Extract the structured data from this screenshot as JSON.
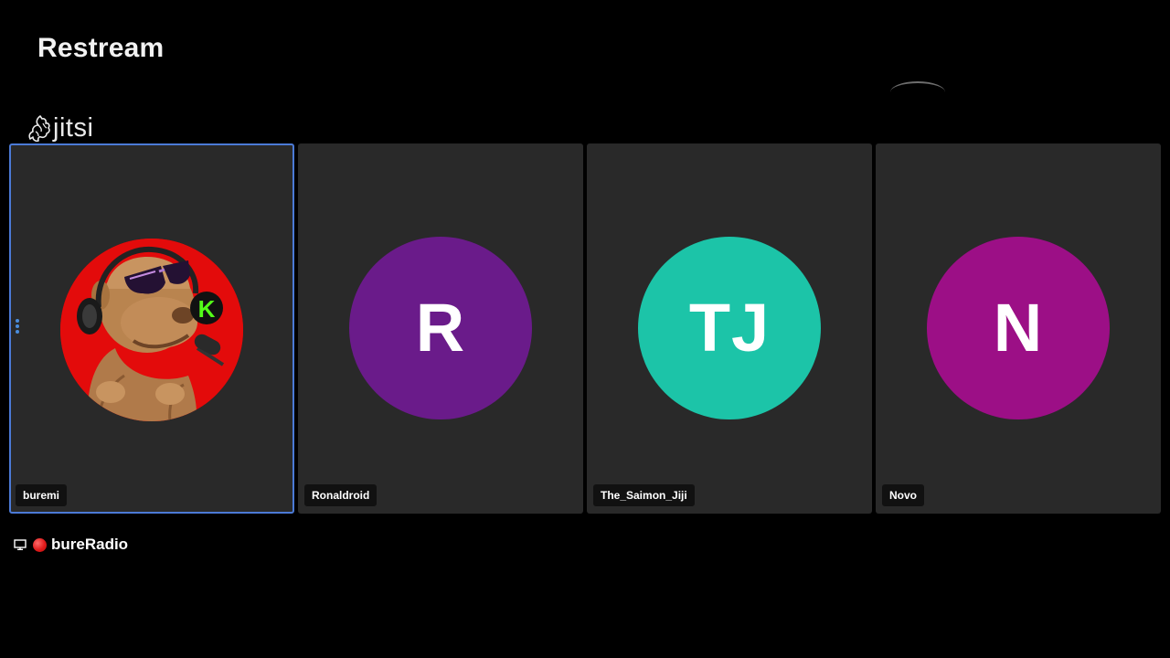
{
  "header": {
    "title": "Restream"
  },
  "logo": {
    "text": "jitsi",
    "icon": "jitsi-logo-icon"
  },
  "participants": [
    {
      "name": "buremi",
      "initials": "",
      "avatar_type": "image",
      "avatar_color": "#e60000",
      "active": true
    },
    {
      "name": "Ronaldroid",
      "initials": "R",
      "avatar_type": "initials",
      "avatar_color": "#6a1b8a",
      "active": false
    },
    {
      "name": "The_Saimon_Jiji",
      "initials": "TJ",
      "avatar_type": "initials",
      "avatar_color": "#1cc4a8",
      "active": false
    },
    {
      "name": "Novo",
      "initials": "N",
      "avatar_type": "initials",
      "avatar_color": "#9c0f86",
      "active": false
    }
  ],
  "footer": {
    "screen_icon": "monitor-icon",
    "record_icon": "red-circle-icon",
    "label": "bureRadio"
  },
  "colors": {
    "background": "#000000",
    "tile_background": "#292929",
    "active_border": "#4b7ad6"
  }
}
